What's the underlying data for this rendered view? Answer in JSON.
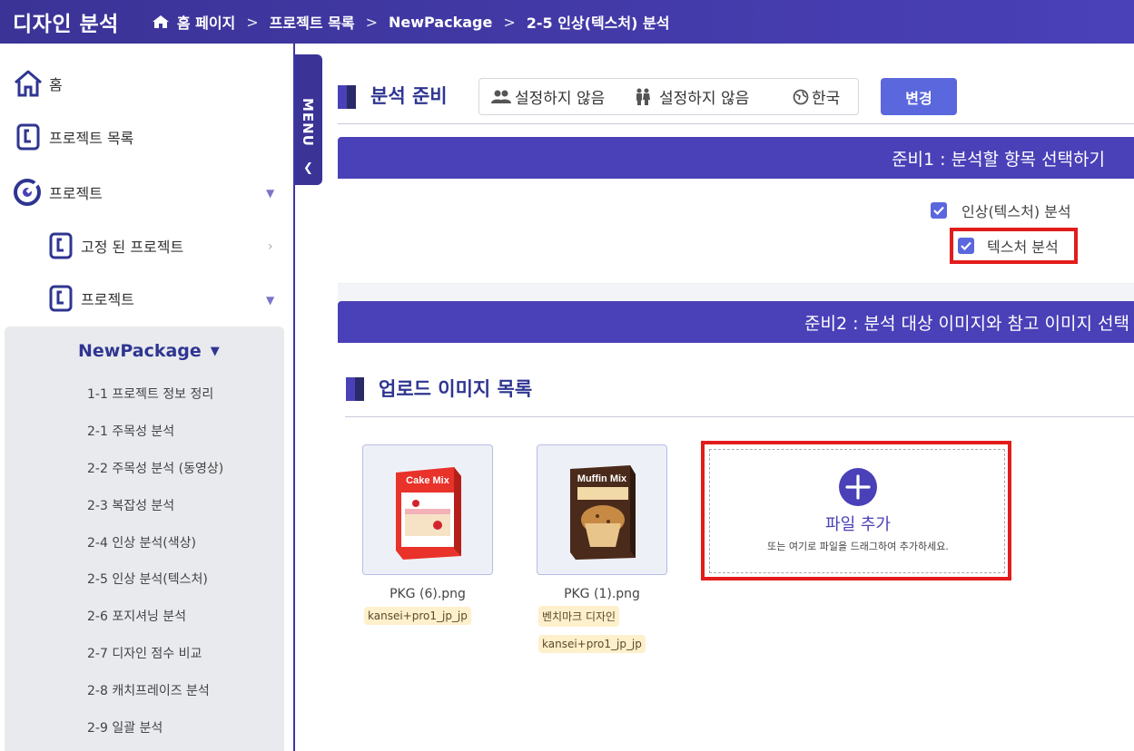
{
  "header": {
    "app_title": "디자인 분석",
    "breadcrumb": [
      "홈 페이지",
      "프로젝트 목록",
      "NewPackage",
      "2-5 인상(텍스처) 분석"
    ]
  },
  "sidebar": {
    "home": "홈",
    "project_list": "프로젝트 목록",
    "projects": "프로젝트",
    "pinned_projects": "고정 된 프로젝트",
    "projects_sub": "프로젝트",
    "package_name": "NewPackage",
    "links": [
      "1-1 프로젝트 정보 정리",
      "2-1 주목성 분석",
      "2-2 주목성 분석 (동영상)",
      "2-3 복잡성 분석",
      "2-4 인상 분석(색상)",
      "2-5 인상 분석(텍스처)",
      "2-6 포지셔닝 분석",
      "2-7 디자인 점수 비교",
      "2-8 캐치프레이즈 분석",
      "2-9 일괄 분석"
    ],
    "menu_tab": "MENU"
  },
  "prep": {
    "title": "분석 준비",
    "filter1": "설정하지 않음",
    "filter2": "설정하지 않음",
    "language": "한국",
    "change_button": "변경"
  },
  "step1": {
    "header": "준비1 : 분석할 항목 선택하기",
    "options": [
      "인상(텍스처) 분석",
      "텍스처 분석"
    ]
  },
  "step2": {
    "header": "준비2 : 분석 대상 이미지와 참고 이미지 선택"
  },
  "upload": {
    "title": "업로드 이미지 목록",
    "images": [
      {
        "filename": "PKG (6).png",
        "tags": [
          "kansei+pro1_jp_jp"
        ],
        "box_text": "Cake Mix"
      },
      {
        "filename": "PKG (1).png",
        "tags": [
          "벤치마크 디자인",
          "kansei+pro1_jp_jp"
        ],
        "box_text": "Muffin Mix"
      }
    ],
    "add_label": "파일 추가",
    "add_hint": "또는 여기로 파일을 드래그하여 추가하세요."
  },
  "colors": {
    "accent": "#4a40b8",
    "button": "#5b67dd",
    "highlight": "#e21c1c"
  }
}
